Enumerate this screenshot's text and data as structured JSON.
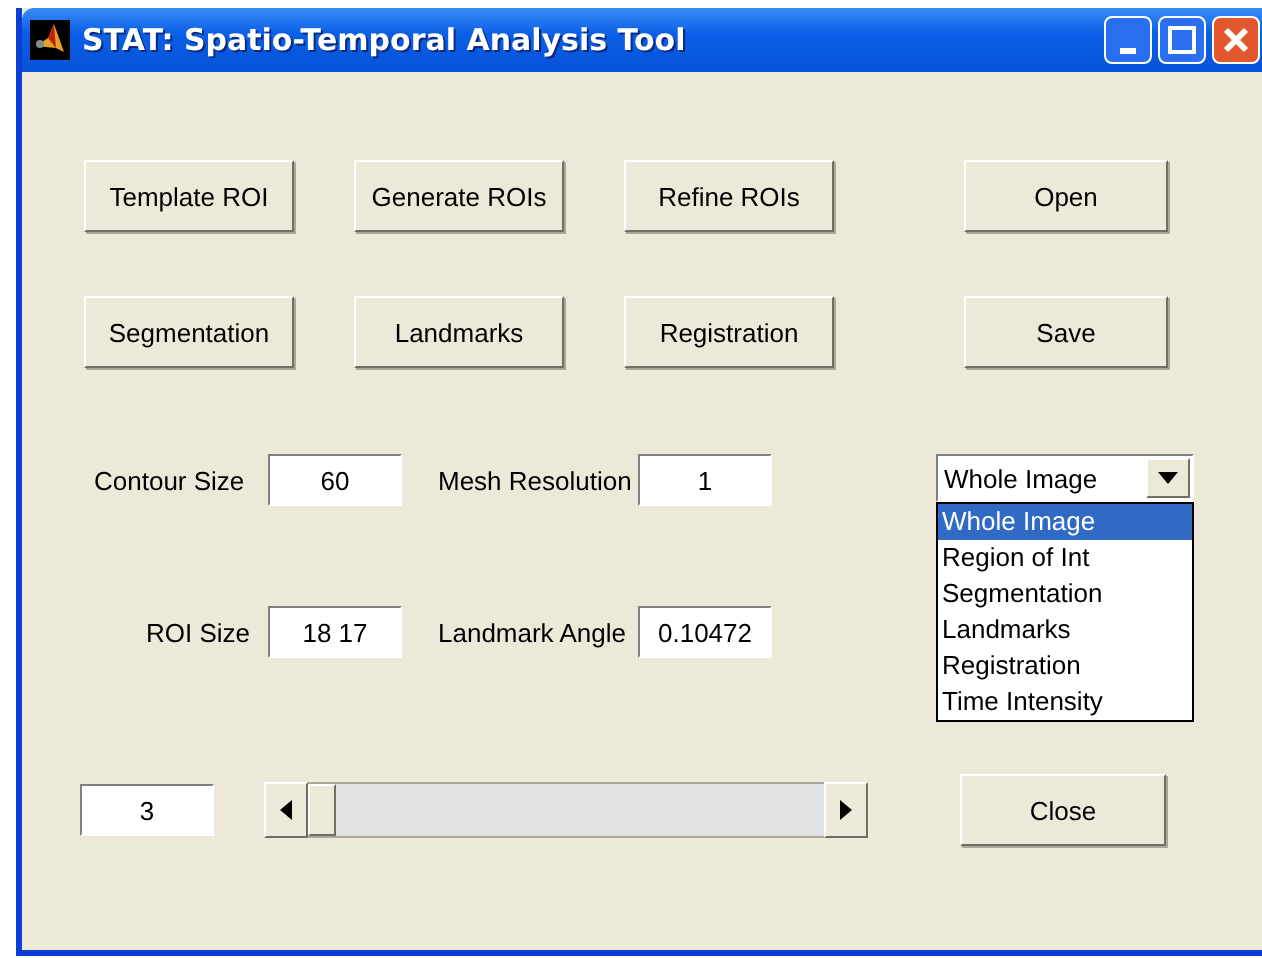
{
  "window": {
    "title": "STAT: Spatio-Temporal Analysis Tool"
  },
  "action_buttons": [
    [
      "Template ROI",
      "Generate ROIs",
      "Refine ROIs"
    ],
    [
      "Segmentation",
      "Landmarks",
      "Registration"
    ]
  ],
  "parameters": [
    {
      "label": "Contour Size",
      "value": "60"
    },
    {
      "label": "Mesh Resolution",
      "value": "1"
    },
    {
      "label": "ROI Size",
      "value": "18 17"
    },
    {
      "label": "Landmark Angle",
      "value": "0.10472"
    }
  ],
  "frame_field": {
    "value": "3"
  },
  "slider": {
    "level": 0
  },
  "file_buttons": [
    "Open",
    "Save"
  ],
  "view_dropdown": {
    "value": "Whole Image",
    "expanded": true,
    "options": [
      {
        "label": "Whole Image",
        "selected": true
      },
      {
        "label": "Region of Int",
        "selected": false
      },
      {
        "label": "Segmentation",
        "selected": false
      },
      {
        "label": "Landmarks",
        "selected": false
      },
      {
        "label": "Registration",
        "selected": false
      },
      {
        "label": "Time Intensity",
        "selected": false
      }
    ]
  },
  "close_button": "Close"
}
